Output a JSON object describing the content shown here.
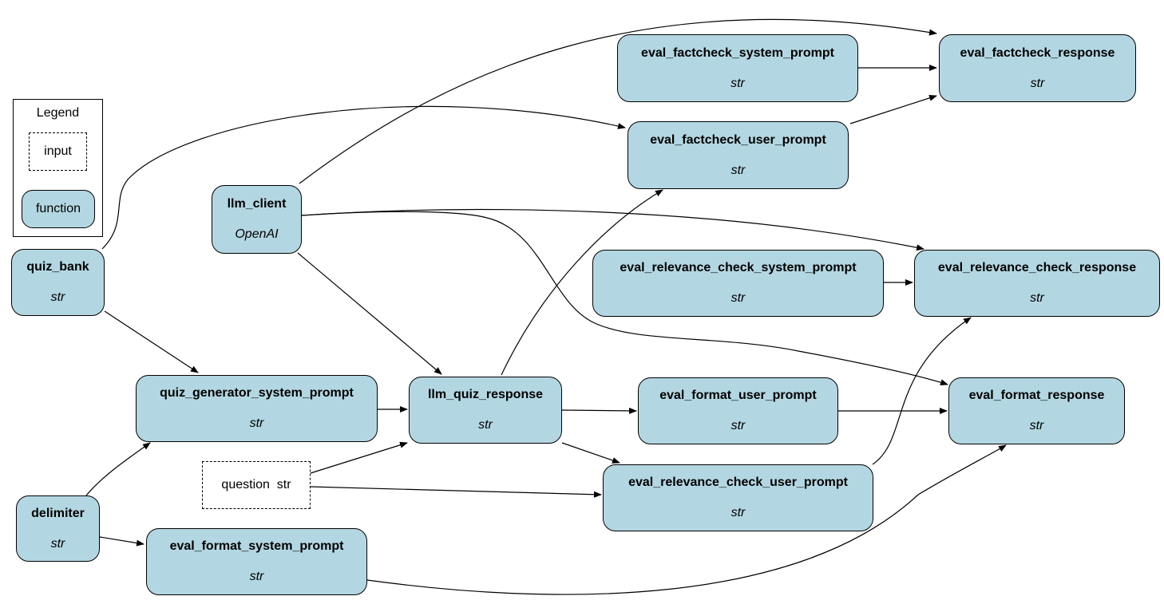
{
  "legend": {
    "title": "Legend",
    "input_label": "input",
    "function_label": "function"
  },
  "node_color": "#b3d7e2",
  "nodes": {
    "quiz_bank": {
      "name": "quiz_bank",
      "type": "str"
    },
    "llm_client": {
      "name": "llm_client",
      "type": "OpenAI"
    },
    "delimiter": {
      "name": "delimiter",
      "type": "str"
    },
    "quiz_generator_system_prompt": {
      "name": "quiz_generator_system_prompt",
      "type": "str"
    },
    "question": {
      "label": "question  str"
    },
    "llm_quiz_response": {
      "name": "llm_quiz_response",
      "type": "str"
    },
    "eval_factcheck_system_prompt": {
      "name": "eval_factcheck_system_prompt",
      "type": "str"
    },
    "eval_factcheck_user_prompt": {
      "name": "eval_factcheck_user_prompt",
      "type": "str"
    },
    "eval_factcheck_response": {
      "name": "eval_factcheck_response",
      "type": "str"
    },
    "eval_relevance_check_system_prompt": {
      "name": "eval_relevance_check_system_prompt",
      "type": "str"
    },
    "eval_relevance_check_response": {
      "name": "eval_relevance_check_response",
      "type": "str"
    },
    "eval_format_user_prompt": {
      "name": "eval_format_user_prompt",
      "type": "str"
    },
    "eval_format_response": {
      "name": "eval_format_response",
      "type": "str"
    },
    "eval_relevance_check_user_prompt": {
      "name": "eval_relevance_check_user_prompt",
      "type": "str"
    },
    "eval_format_system_prompt": {
      "name": "eval_format_system_prompt",
      "type": "str"
    }
  }
}
